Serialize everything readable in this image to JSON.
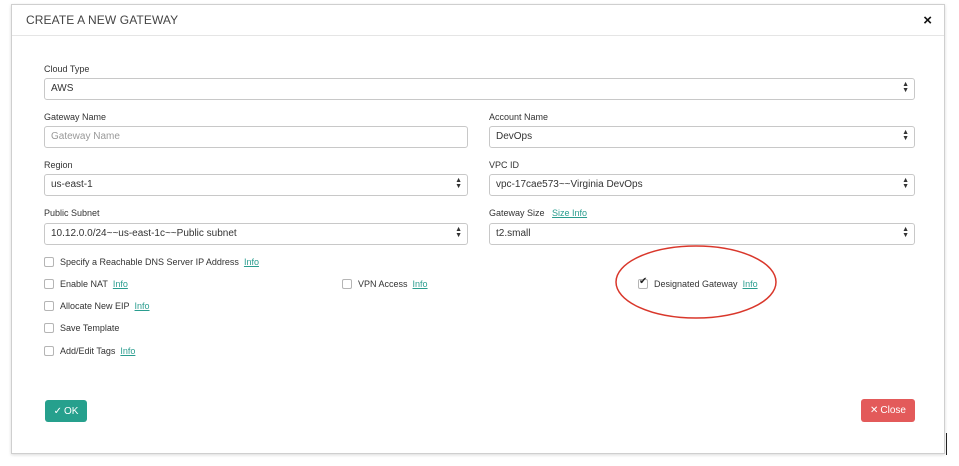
{
  "modal": {
    "title": "CREATE A NEW GATEWAY",
    "close_icon": "×"
  },
  "form": {
    "cloud_type": {
      "label": "Cloud Type",
      "value": "AWS"
    },
    "gateway_name": {
      "label": "Gateway Name",
      "placeholder": "Gateway Name",
      "value": ""
    },
    "account_name": {
      "label": "Account Name",
      "value": "DevOps"
    },
    "region": {
      "label": "Region",
      "value": "us-east-1"
    },
    "vpc_id": {
      "label": "VPC ID",
      "value": "vpc-17cae573~~Virginia DevOps"
    },
    "public_subnet": {
      "label": "Public Subnet",
      "value": "10.12.0.0/24~~us-east-1c~~Public subnet"
    },
    "gateway_size": {
      "label": "Gateway Size",
      "info_link": "Size Info",
      "value": "t2.small"
    }
  },
  "options": {
    "dns_server": {
      "label": "Specify a Reachable DNS Server IP Address",
      "info": "Info",
      "checked": false
    },
    "enable_nat": {
      "label": "Enable NAT",
      "info": "Info",
      "checked": false
    },
    "vpn_access": {
      "label": "VPN Access",
      "info": "Info",
      "checked": false
    },
    "designated_gateway": {
      "label": "Designated Gateway",
      "info": "Info",
      "checked": true
    },
    "allocate_eip": {
      "label": "Allocate New EIP",
      "info": "Info",
      "checked": false
    },
    "save_template": {
      "label": "Save Template",
      "checked": false
    },
    "add_edit_tags": {
      "label": "Add/Edit Tags",
      "info": "Info",
      "checked": false
    }
  },
  "buttons": {
    "ok": {
      "icon": "✓",
      "label": "OK"
    },
    "close": {
      "icon": "✕",
      "label": "Close"
    }
  },
  "colors": {
    "ok_green": "#26a08d",
    "close_red": "#e35a5a",
    "info_link": "#2a9d8f",
    "highlight_ellipse": "#d9372b"
  },
  "icons": {
    "close": "close-icon",
    "select_arrow": "updown-arrow-icon",
    "checkmark": "check-icon"
  }
}
